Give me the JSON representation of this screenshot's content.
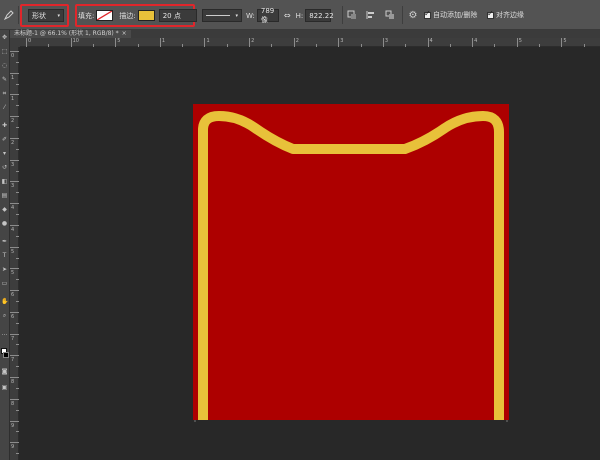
{
  "options_bar": {
    "tool_icon": "pen-icon",
    "mode_value": "形状",
    "fill_label": "填充:",
    "stroke_label": "描边:",
    "stroke_width_value": "20 点",
    "width_label": "W:",
    "width_value": "789 像",
    "link_icon": "link-icon",
    "height_label": "H:",
    "height_value": "822.22",
    "path_ops_icon": "path-operations-icon",
    "align_icon": "path-alignment-icon",
    "arrange_icon": "path-arrangement-icon",
    "gear_icon": "gear-icon",
    "auto_add_delete_label": "自动添加/删除",
    "align_edges_label": "对齐边缘",
    "fill_color": "#ffffff",
    "stroke_color": "#e8c13a"
  },
  "document_tab": {
    "title": "未标题-1 @ 66.1% (形状 1, RGB/8) *",
    "close": "×"
  },
  "ruler": {
    "h_labels": [
      "0",
      "10",
      "5",
      "1",
      "1",
      "2",
      "2",
      "3",
      "3",
      "4",
      "4",
      "5",
      "5"
    ],
    "v_labels": [
      "0",
      "1",
      "1",
      "2",
      "2",
      "3",
      "3",
      "4",
      "4",
      "5",
      "5",
      "6",
      "6",
      "7",
      "7",
      "8",
      "8",
      "9",
      "9"
    ]
  },
  "artwork": {
    "background_color": "#ad0000",
    "stroke_color": "#e8c13a"
  }
}
